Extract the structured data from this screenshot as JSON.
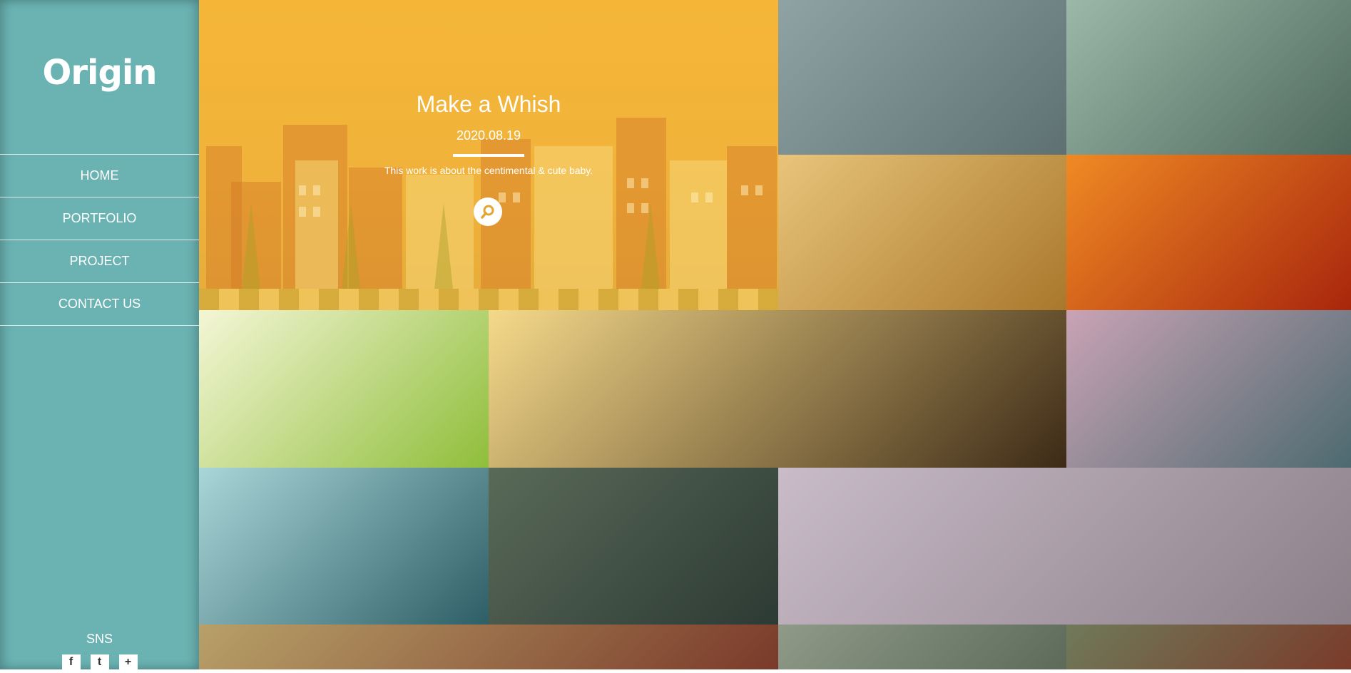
{
  "sidebar": {
    "logo": "Origin",
    "nav": [
      "HOME",
      "PORTFOLIO",
      "PROJECT",
      "CONTACT US"
    ],
    "sns_label": "SNS",
    "sns_icons": [
      {
        "name": "facebook-icon",
        "glyph": "f"
      },
      {
        "name": "twitter-icon",
        "glyph": "t"
      },
      {
        "name": "google-plus-icon",
        "glyph": "+"
      }
    ]
  },
  "featured": {
    "title": "Make a Whish",
    "date": "2020.08.19",
    "description": "This work is about the centimental & cute baby.",
    "icon": "search-icon"
  },
  "gallery": [
    {
      "name": "tile-bare-branches",
      "colors": [
        "#8fa3a5",
        "#5e7072"
      ]
    },
    {
      "name": "tile-misty-forest",
      "colors": [
        "#9bb8a8",
        "#4f6a5e"
      ]
    },
    {
      "name": "tile-wheat-field",
      "colors": [
        "#e8c47a",
        "#a9782c"
      ]
    },
    {
      "name": "tile-autumn-leaves",
      "colors": [
        "#f08a24",
        "#a8260c"
      ]
    },
    {
      "name": "tile-ladybug-sprout",
      "colors": [
        "#f4f6d6",
        "#8fbe3a"
      ]
    },
    {
      "name": "tile-forest-path",
      "colors": [
        "#f5d98a",
        "#3d2a16"
      ]
    },
    {
      "name": "tile-butterfly-wheat",
      "colors": [
        "#c9a3b5",
        "#4d6a70"
      ]
    },
    {
      "name": "tile-blue-forest",
      "colors": [
        "#a9d6d8",
        "#2e5e66"
      ]
    },
    {
      "name": "tile-girl-in-grass",
      "colors": [
        "#5a6a58",
        "#2c3a34"
      ]
    },
    {
      "name": "tile-girl-on-beach",
      "colors": [
        "#c9bcc8",
        "#8b7f88"
      ]
    },
    {
      "name": "tile-painted-scene",
      "colors": [
        "#b8a068",
        "#7a3a2a"
      ]
    },
    {
      "name": "tile-castle",
      "colors": [
        "#8f9a88",
        "#5d6a5a"
      ]
    },
    {
      "name": "tile-clock-fantasy",
      "colors": [
        "#6f7a5a",
        "#7a3b2a"
      ]
    }
  ]
}
